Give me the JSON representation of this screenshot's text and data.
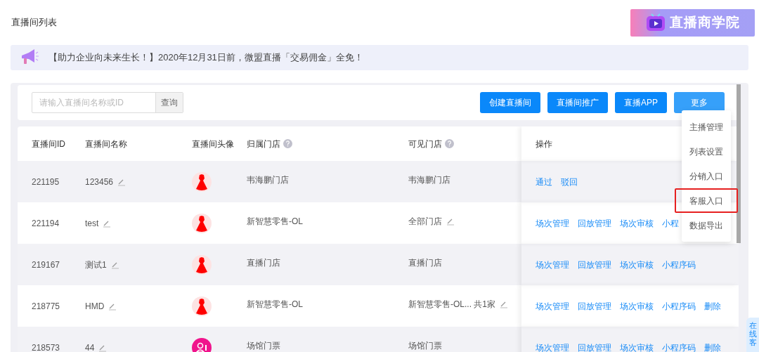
{
  "page_title": "直播间列表",
  "promo_logo": {
    "text": "直播商学院"
  },
  "notice": {
    "text": "【助力企业向未来生长！】2020年12月31日前，微盟直播「交易佣金」全免！"
  },
  "search": {
    "placeholder": "请输入直播间名称或ID",
    "button": "查询"
  },
  "toolbar_buttons": [
    {
      "label": "创建直播间",
      "active": false
    },
    {
      "label": "直播间推广",
      "active": false
    },
    {
      "label": "直播APP",
      "active": false
    },
    {
      "label": "更多",
      "active": true
    }
  ],
  "more_menu": [
    {
      "label": "主播管理",
      "highlighted": false
    },
    {
      "label": "列表设置",
      "highlighted": false
    },
    {
      "label": "分销入口",
      "highlighted": false
    },
    {
      "label": "客服入口",
      "highlighted": true
    },
    {
      "label": "数据导出",
      "highlighted": false
    }
  ],
  "table": {
    "columns": [
      {
        "label": "直播间ID"
      },
      {
        "label": "直播间名称"
      },
      {
        "label": "直播间头像"
      },
      {
        "label": "归属门店",
        "help": true
      },
      {
        "label": "可见门店",
        "help": true
      },
      {
        "label": "操作"
      }
    ],
    "rows": [
      {
        "id": "221195",
        "name": "123456",
        "avatar": {
          "kind": "dress"
        },
        "store": "韦海鹏门店",
        "visible_store": "韦海鹏门店",
        "visible_editable": false,
        "actions": [
          "通过",
          "驳回"
        ]
      },
      {
        "id": "221194",
        "name": "test",
        "avatar": {
          "kind": "dress"
        },
        "store": "新智慧零售-OL",
        "visible_store": "全部门店",
        "visible_editable": true,
        "actions": [
          "场次管理",
          "回放管理",
          "场次审核",
          "小程"
        ]
      },
      {
        "id": "219167",
        "name": "测试1",
        "avatar": {
          "kind": "dress"
        },
        "store": "直播门店",
        "visible_store": "直播门店",
        "visible_editable": false,
        "actions": [
          "场次管理",
          "回放管理",
          "场次审核",
          "小程序码"
        ]
      },
      {
        "id": "218775",
        "name": "HMD",
        "avatar": {
          "kind": "dress"
        },
        "store": "新智慧零售-OL",
        "visible_store": "新智慧零售-OL... 共1家",
        "visible_editable": true,
        "actions": [
          "场次管理",
          "回放管理",
          "场次审核",
          "小程序码",
          "删除"
        ]
      },
      {
        "id": "218573",
        "name": "44",
        "avatar": {
          "kind": "badge"
        },
        "store": "场馆门票",
        "visible_store": "场馆门票",
        "visible_editable": false,
        "actions": [
          "场次管理",
          "回放管理",
          "场次审核",
          "小程序码",
          "删除"
        ]
      }
    ]
  },
  "side_tab": {
    "text": "在线客"
  }
}
